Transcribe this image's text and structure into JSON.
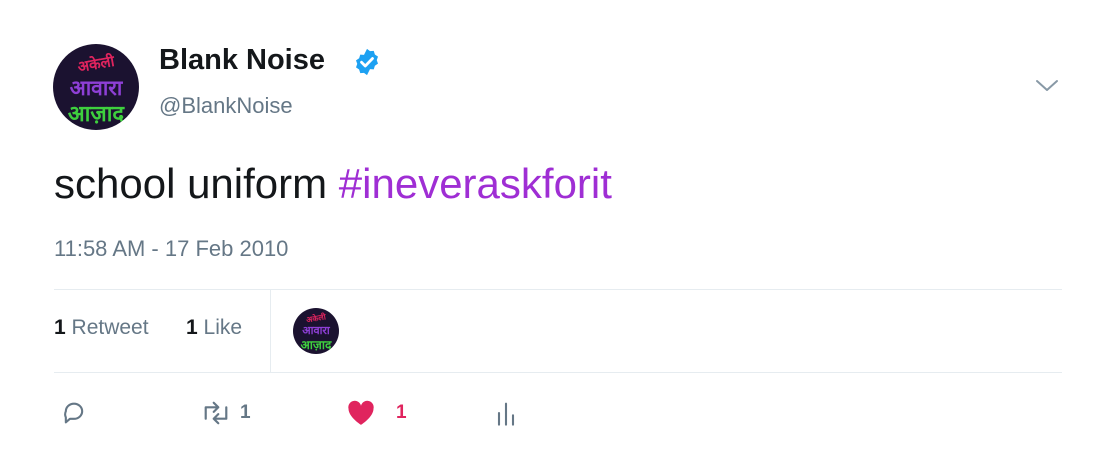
{
  "tweet": {
    "display_name": "Blank Noise",
    "handle": "@BlankNoise",
    "text_plain": "school uniform ",
    "hashtag": "#ineveraskforit",
    "timestamp": "11:58 AM - 17 Feb 2010",
    "avatar_text": [
      "अकेली",
      "आवारा",
      "आज़ाद"
    ]
  },
  "stats": {
    "retweets_count": "1",
    "retweets_label": "Retweet",
    "likes_count": "1",
    "likes_label": "Like"
  },
  "actions": {
    "reply_icon": "reply-icon",
    "retweet_icon": "retweet-icon",
    "retweet_count": "1",
    "like_icon": "heart-icon",
    "like_count": "1",
    "analytics_icon": "analytics-icon"
  },
  "colors": {
    "hashtag": "#9f2ed4",
    "verified": "#1da1f2",
    "like": "#e0245e",
    "muted": "#657786"
  }
}
